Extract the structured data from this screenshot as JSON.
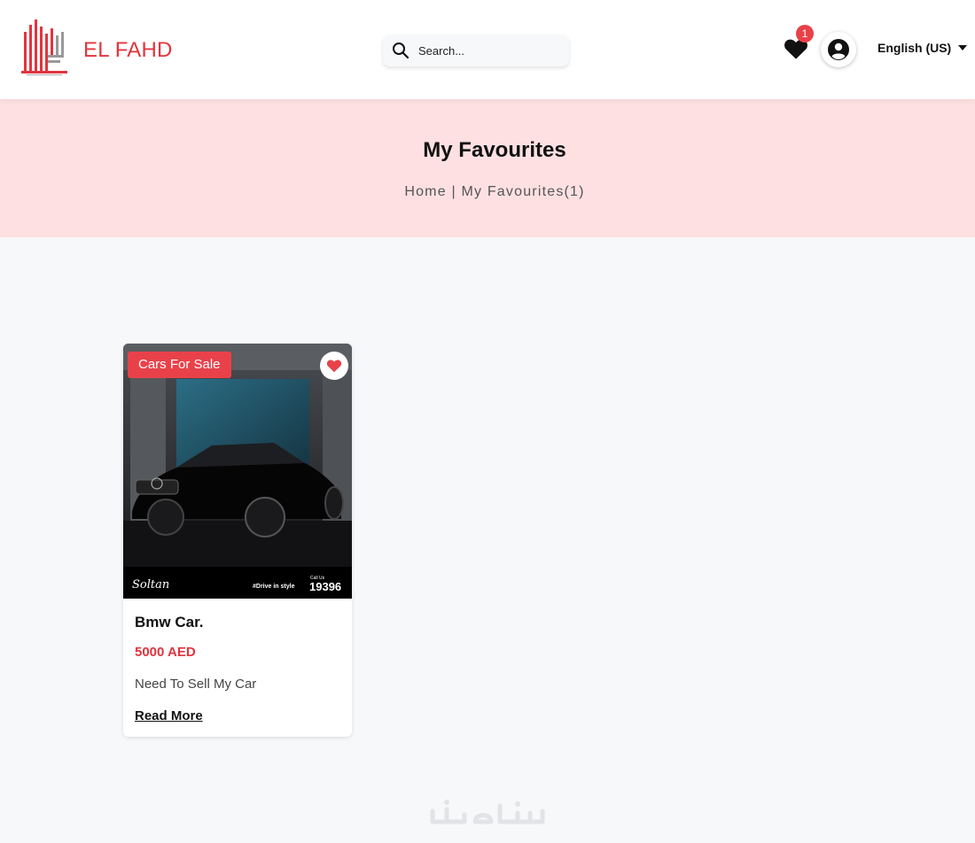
{
  "header": {
    "brand_name": "EL FAHD",
    "search_placeholder": "Search...",
    "favorites_count": "1",
    "language": "English (US)"
  },
  "hero": {
    "title": "My Favourites",
    "breadcrumb": {
      "home": "Home",
      "separator": " | ",
      "current": "My Favourites(1)"
    }
  },
  "favourites": [
    {
      "category": "Cars For Sale",
      "title": "Bmw Car.",
      "price": "5000 AED",
      "description": "Need To Sell My Car",
      "link_label": "Read More",
      "favourited": true,
      "image": {
        "brand_text": "Soltan",
        "slogan": "#Drive in style",
        "call_label": "Call Us",
        "phone": "19396"
      }
    }
  ],
  "colors": {
    "brand_red": "#e2343d",
    "hero_bg": "#ffe0e2",
    "page_bg": "#f7f8fa"
  },
  "icons": {
    "search": "search-icon",
    "favorites": "heart-icon",
    "account": "account-icon",
    "language_caret": "caret-down-icon"
  }
}
